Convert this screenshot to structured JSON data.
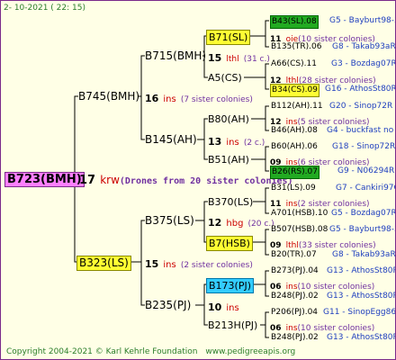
{
  "header": {
    "date": "2- 10-2021 ( 22: 15)"
  },
  "footer": {
    "copyright": "Copyright 2004-2021 © Karl Kehrle Foundation",
    "site": "www.pedigreeapis.org"
  },
  "colors": {
    "pink": "#ff7fff",
    "yellow": "#ffff33",
    "green": "#22aa22",
    "cyan": "#33ccff",
    "kw_red": "#cc0000",
    "note_purple": "#7030a0",
    "tag_blue": "#1f3fbf"
  },
  "root": {
    "id": "B723(BMH)",
    "num": "17",
    "kw": "krw",
    "note": "(Drones from 20 sister colonies)"
  },
  "gen1": {
    "sire": {
      "id": "B745(BMH)",
      "num": "16",
      "kw": "ins",
      "note": "(7 sister colonies)"
    },
    "dam": {
      "id": "B323(LS)",
      "num": "15",
      "kw": "ins",
      "note": "(2 sister colonies)"
    }
  },
  "gen2": {
    "b715": {
      "id": "B715(BMH)",
      "num": "15",
      "kw": "lthl",
      "note": "(31 c.)"
    },
    "b145": {
      "id": "B145(AH)",
      "num": "13",
      "kw": "ins",
      "note": "(2 c.)"
    },
    "b375": {
      "id": "B375(LS)",
      "num": "12",
      "kw": "hbg",
      "note": "(20 c.)"
    },
    "b235": {
      "id": "B235(PJ)",
      "num": "10",
      "kw": "ins",
      "note": ""
    }
  },
  "gen3": {
    "b71": {
      "id": "B71(SL)",
      "num": "11",
      "kw": "oie",
      "note": "(10 sister colonies)"
    },
    "a5": {
      "id": "A5(CS)",
      "num": "12",
      "kw": "lthl",
      "note": "(28 sister colonies)"
    },
    "b80": {
      "id": "B80(AH)",
      "num": "12",
      "kw": "ins",
      "note": "(5 sister colonies)"
    },
    "b51": {
      "id": "B51(AH)",
      "num": "09",
      "kw": "ins",
      "note": "(6 sister colonies)"
    },
    "b370": {
      "id": "B370(LS)",
      "num": "11",
      "kw": "ins",
      "note": "(2 sister colonies)"
    },
    "b7": {
      "id": "B7(HSB)",
      "num": "09",
      "kw": "lthl",
      "note": "(33 sister colonies)"
    },
    "b173": {
      "id": "B173(PJ)",
      "num": "06",
      "kw": "ins",
      "note": "(10 sister colonies)"
    },
    "b213": {
      "id": "B213H(PJ)",
      "num": "06",
      "kw": "ins",
      "note": "(10 sister colonies)"
    }
  },
  "gen4": [
    {
      "id": "B43(SL).08",
      "tag": "G5 - Bayburt98-3"
    },
    {
      "id": "B135(TR).06",
      "tag": "G8 - Takab93aR"
    },
    {
      "id": "A66(CS).11",
      "tag": "G3 - Bozdag07R"
    },
    {
      "id": "B34(CS).09",
      "tag": "G16 - AthosSt80R"
    },
    {
      "id": "B112(AH).11",
      "tag": "G20 - Sinop72R"
    },
    {
      "id": "B46(AH).08",
      "tag": "G4 - buckfast no"
    },
    {
      "id": "B60(AH).06",
      "tag": "G18 - Sinop72R"
    },
    {
      "id": "B26(RS).07",
      "tag": "G9 - N06294R"
    },
    {
      "id": "B31(LS).09",
      "tag": "G7 - Cankiri97Q"
    },
    {
      "id": "A701(HSB).10",
      "tag": "G5 - Bozdag07R"
    },
    {
      "id": "B507(HSB).08",
      "tag": "G5 - Bayburt98-3"
    },
    {
      "id": "B20(TR).07",
      "tag": "G8 - Takab93aR"
    },
    {
      "id": "B273(PJ).04",
      "tag": "G13 - AthosSt80R"
    },
    {
      "id": "B248(PJ).02",
      "tag": "G13 - AthosSt80R"
    },
    {
      "id": "P206(PJ).04",
      "tag": "G11 - SinopEgg86R"
    },
    {
      "id": "B248(PJ).02",
      "tag": "G13 - AthosSt80R"
    }
  ]
}
